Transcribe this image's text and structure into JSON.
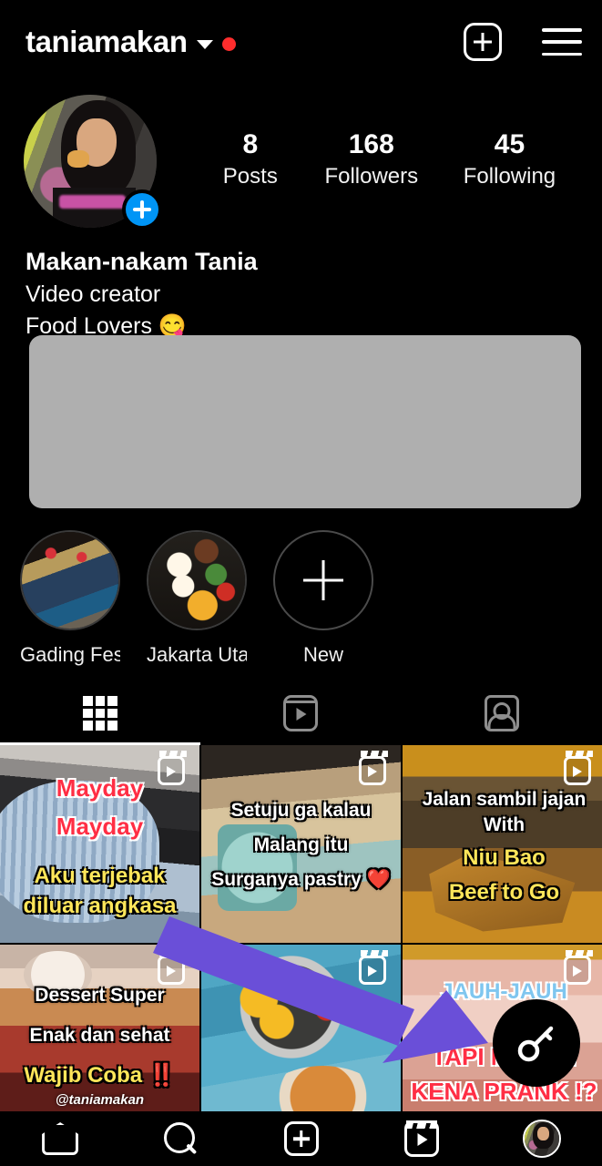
{
  "app": "instagram-profile",
  "header": {
    "username": "taniamakan",
    "dropdown_icon": "chevron-down-icon",
    "notification_dot": "red-dot-badge",
    "create_icon": "plus-box-icon",
    "menu_icon": "hamburger-menu-icon"
  },
  "profile": {
    "avatar_badge_icon": "plus-icon",
    "stats": [
      {
        "value": "8",
        "label": "Posts"
      },
      {
        "value": "168",
        "label": "Followers"
      },
      {
        "value": "45",
        "label": "Following"
      }
    ],
    "display_name": "Makan-nakam Tania",
    "category": "Video creator",
    "bio_line": "Food Lovers 😋"
  },
  "redacted_block": {
    "color": "#AFAFAF"
  },
  "highlights": [
    {
      "label": "Gading Fest...",
      "type": "image"
    },
    {
      "label": "Jakarta Utara",
      "type": "image"
    },
    {
      "label": "New",
      "type": "add",
      "icon": "plus-icon"
    }
  ],
  "tabs": [
    {
      "name": "grid",
      "icon": "grid-icon",
      "active": true
    },
    {
      "name": "reels",
      "icon": "reels-icon",
      "active": false
    },
    {
      "name": "tagged",
      "icon": "tagged-person-icon",
      "active": false
    }
  ],
  "posts": [
    {
      "id": "post-1",
      "badge": "reel-icon",
      "captions": [
        {
          "text": "Mayday",
          "style": "red"
        },
        {
          "text": "Mayday",
          "style": "red"
        },
        {
          "text": "Aku terjebak",
          "style": "yellow"
        },
        {
          "text": "diluar angkasa",
          "style": "yellow"
        }
      ]
    },
    {
      "id": "post-2",
      "badge": "reel-icon",
      "captions": [
        {
          "text": "Setuju ga kalau",
          "style": "white"
        },
        {
          "text": "Malang itu",
          "style": "white"
        },
        {
          "text": "Surganya pastry ❤️",
          "style": "white"
        }
      ]
    },
    {
      "id": "post-3",
      "badge": "reel-icon",
      "captions": [
        {
          "text": "Jalan sambil jajan",
          "style": "white"
        },
        {
          "text": "With",
          "style": "white"
        },
        {
          "text": "Niu Bao",
          "style": "yellow"
        },
        {
          "text": "Beef to Go",
          "style": "yellow"
        }
      ]
    },
    {
      "id": "post-4",
      "badge": "reel-icon",
      "captions": [
        {
          "text": "Dessert Super",
          "style": "white"
        },
        {
          "text": "Enak dan sehat",
          "style": "white"
        },
        {
          "text": "Wajib Coba ‼️",
          "style": "yellow"
        }
      ],
      "watermark": "@taniamakan"
    },
    {
      "id": "post-5",
      "badge": "reel-icon",
      "captions": []
    },
    {
      "id": "post-6",
      "badge": "reel-icon",
      "captions": [
        {
          "text": "JAUH-JAUH",
          "style": "blue"
        },
        {
          "text": "TAPI MALAH",
          "style": "red"
        },
        {
          "text": "KENA PRANK !?",
          "style": "red"
        }
      ]
    }
  ],
  "annotation": {
    "arrow_color": "#6A4FD8",
    "arrow_name": "purple-pointer-arrow",
    "target_icon": "key-icon",
    "target_bubble_color": "#000000"
  },
  "bottom_nav": [
    {
      "name": "home",
      "icon": "home-icon"
    },
    {
      "name": "search",
      "icon": "search-icon"
    },
    {
      "name": "create",
      "icon": "plus-box-icon"
    },
    {
      "name": "reels",
      "icon": "reels-icon"
    },
    {
      "name": "profile",
      "icon": "profile-avatar-icon"
    }
  ]
}
